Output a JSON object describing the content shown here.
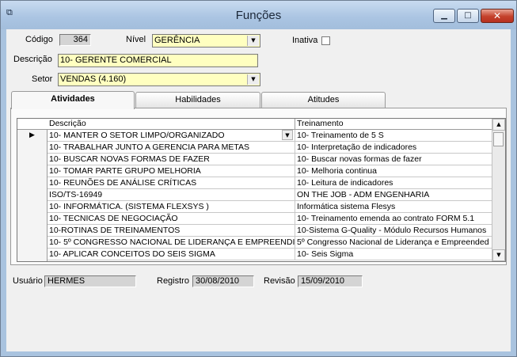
{
  "window": {
    "title": "Funções",
    "app_icon": "app-window-icon",
    "min_glyph": "▁",
    "max_glyph": "□",
    "close_glyph": "✕"
  },
  "form": {
    "codigo_label": "Código",
    "codigo_value": "364",
    "nivel_label": "Nível",
    "nivel_value": "GERÊNCIA",
    "inativa_label": "Inativa",
    "inativa_checked": false,
    "descricao_label": "Descrição",
    "descricao_value": "10- GERENTE COMERCIAL",
    "setor_label": "Setor",
    "setor_value": "VENDAS (4.160)",
    "dropdown_glyph": "▼"
  },
  "tabs": [
    {
      "label": "Atividades",
      "active": true
    },
    {
      "label": "Habilidades",
      "active": false
    },
    {
      "label": "Atitudes",
      "active": false
    }
  ],
  "grid": {
    "columns": [
      "Descrição",
      "Treinamento"
    ],
    "current_row_glyph": "▶",
    "rows": [
      {
        "descricao": "10- MANTER O SETOR LIMPO/ORGANIZADO",
        "treinamento": "10- Treinamento de 5 S"
      },
      {
        "descricao": "10- TRABALHAR JUNTO A GERENCIA PARA METAS",
        "treinamento": "10- Interpretação de indicadores"
      },
      {
        "descricao": "10- BUSCAR NOVAS FORMAS DE FAZER",
        "treinamento": "10- Buscar novas formas de fazer"
      },
      {
        "descricao": "10- TOMAR PARTE GRUPO MELHORIA",
        "treinamento": "10- Melhoria continua"
      },
      {
        "descricao": "10-  REUNÕES DE ANÁLISE CRÍTICAS",
        "treinamento": "10- Leitura de indicadores"
      },
      {
        "descricao": "ISO/TS-16949",
        "treinamento": "ON THE JOB - ADM ENGENHARIA"
      },
      {
        "descricao": "10- INFORMÁTICA. (SISTEMA FLEXSYS )",
        "treinamento": "Informática sistema Flesys"
      },
      {
        "descricao": "10- TECNICAS DE NEGOCIAÇÃO",
        "treinamento": "10- Treinamento emenda ao contrato  FORM 5.1"
      },
      {
        "descricao": "10-ROTINAS DE TREINAMENTOS",
        "treinamento": "10-Sistema G-Quality - Módulo Recursos Humanos"
      },
      {
        "descricao": "10- 5º CONGRESSO NACIONAL DE LIDERANÇA E EMPREENDI",
        "treinamento": "5º Congresso Nacional de Liderança e Empreended"
      },
      {
        "descricao": "10- APLICAR CONCEITOS DO SEIS SIGMA",
        "treinamento": "10- Seis Sigma"
      }
    ],
    "scroll_up_glyph": "▲",
    "scroll_down_glyph": "▼"
  },
  "footer": {
    "usuario_label": "Usuário",
    "usuario_value": "HERMES",
    "registro_label": "Registro",
    "registro_value": "30/08/2010",
    "revisao_label": "Revisão",
    "revisao_value": "15/09/2010"
  }
}
